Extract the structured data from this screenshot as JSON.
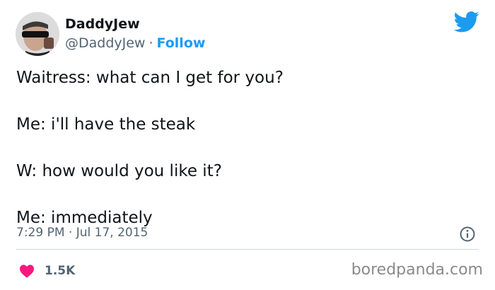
{
  "author": {
    "display_name": "DaddyJew",
    "handle": "@DaddyJew",
    "separator": "·",
    "follow_label": "Follow"
  },
  "tweet": {
    "lines": [
      "Waitress: what can I get for you?",
      "Me: i'll have the steak",
      "W: how would you like it?",
      "Me: immediately"
    ],
    "timestamp": "7:29 PM · Jul 17, 2015"
  },
  "engagement": {
    "likes": "1.5K"
  },
  "watermark": "boredpanda.com",
  "icons": {
    "brand": "twitter-bird-icon",
    "info": "info-icon",
    "like": "heart-icon",
    "avatar": "avatar-photo"
  },
  "colors": {
    "brand_blue": "#1d9bf0",
    "like_red": "#f91880",
    "secondary_text": "#536471",
    "primary_text": "#0f1419",
    "divider": "#cfd9de"
  }
}
